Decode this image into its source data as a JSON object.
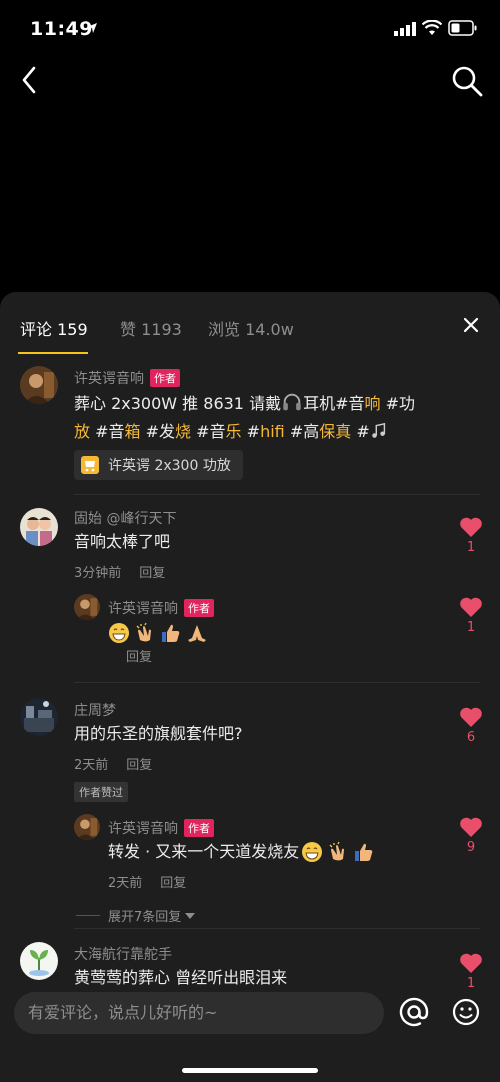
{
  "status": {
    "time": "11:49"
  },
  "tabs": [
    {
      "label": "评论 159"
    },
    {
      "label": "赞 1193"
    },
    {
      "label": "浏览 14.0w"
    }
  ],
  "post": {
    "author": "许英谔音响",
    "author_badge": "作者",
    "content": {
      "p1": "葬心 2x300W 推 8631 请戴",
      "p2": "耳机#音",
      "p3": "响",
      "p4": " #功",
      "p5": "放",
      "p6": " #音",
      "p7": "箱",
      "p8": " #发",
      "p9": "烧",
      "p10": " #音",
      "p11": "乐",
      "p12": " #",
      "p13": "hifi",
      "p14": " #高",
      "p15": "保真",
      "p16": " #"
    },
    "product_chip": "许英谔 2x300 功放"
  },
  "comments": [
    {
      "user": "固始 @峰行天下",
      "text": "音响太棒了吧",
      "time": "3分钟前",
      "reply_label": "回复",
      "likes": "1",
      "reply": {
        "user": "许英谔音响",
        "badge": "作者",
        "reply_label": "回复",
        "likes": "1"
      }
    },
    {
      "user": "庄周梦",
      "text": "用的乐圣的旗舰套件吧?",
      "time": "2天前",
      "reply_label": "回复",
      "author_liked": "作者赞过",
      "likes": "6",
      "reply": {
        "user": "许英谔音响",
        "badge": "作者",
        "text": "转发 · 又来一个天道发烧友",
        "time": "2天前",
        "reply_label": "回复",
        "likes": "9"
      },
      "expand_label": "展开7条回复"
    },
    {
      "user": "大海航行靠舵手",
      "text": "黄莺莺的葬心 曾经听出眼泪来",
      "likes": "1"
    }
  ],
  "input": {
    "placeholder": "有爱评论，说点儿好听的~"
  },
  "colors": {
    "accent": "#f5c518",
    "like": "#e94f6a",
    "badge": "#e0245e",
    "hashtag": "#f5b936"
  }
}
